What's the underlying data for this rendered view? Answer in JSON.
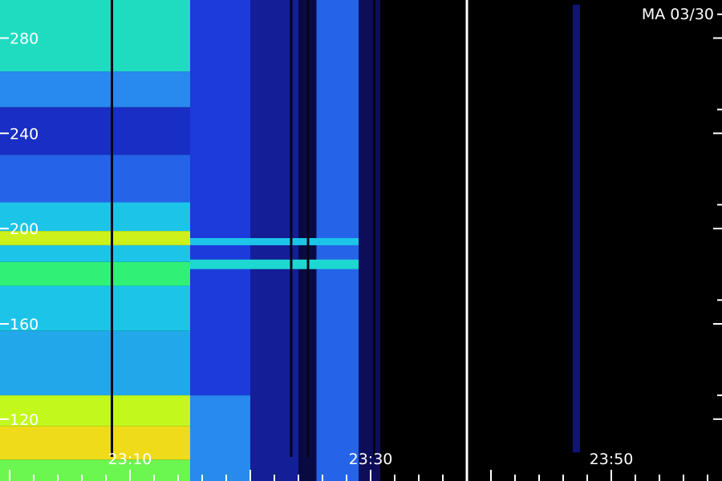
{
  "chart_data": {
    "type": "heatmap",
    "title": "",
    "xlabel": "",
    "ylabel": "",
    "stamp": "MA 03/30",
    "x_tick_labels": [
      "23:10",
      "23:30",
      "23:50"
    ],
    "y_tick_labels": [
      "120",
      "160",
      "200",
      "240",
      "280"
    ],
    "y_ticks": [
      120,
      160,
      200,
      240,
      280
    ],
    "ylim": [
      94,
      296
    ],
    "x_tick_minutes": [
      10,
      30,
      50
    ],
    "xlim_minutes": [
      -0.8,
      59.2
    ],
    "x_minor_step_minutes": 2,
    "gap_start_minutes": 30.8,
    "separator_minutes": 38.0,
    "colormap": [
      "#000000",
      "#10106a",
      "#1a34d8",
      "#2a7cf0",
      "#1ad2e6",
      "#2af07a",
      "#b8ff1c",
      "#ffd21a"
    ],
    "intensity_scale": [
      0,
      1
    ],
    "intensity_regions": [
      {
        "t0": -0.8,
        "t1": 15.0,
        "f0": 94,
        "f1": 103,
        "intensity": 0.78
      },
      {
        "t0": -0.8,
        "t1": 15.0,
        "f0": 103,
        "f1": 117,
        "intensity": 0.97
      },
      {
        "t0": -0.8,
        "t1": 15.0,
        "f0": 117,
        "f1": 130,
        "intensity": 0.88
      },
      {
        "t0": -0.8,
        "t1": 15.0,
        "f0": 130,
        "f1": 157,
        "intensity": 0.5
      },
      {
        "t0": -0.8,
        "t1": 15.0,
        "f0": 157,
        "f1": 176,
        "intensity": 0.55
      },
      {
        "t0": -0.8,
        "t1": 15.0,
        "f0": 176,
        "f1": 186,
        "intensity": 0.72
      },
      {
        "t0": -0.8,
        "t1": 15.0,
        "f0": 186,
        "f1": 193,
        "intensity": 0.55
      },
      {
        "t0": -0.8,
        "t1": 15.0,
        "f0": 193,
        "f1": 199,
        "intensity": 0.9
      },
      {
        "t0": -0.8,
        "t1": 15.0,
        "f0": 199,
        "f1": 211,
        "intensity": 0.55
      },
      {
        "t0": -0.8,
        "t1": 15.0,
        "f0": 211,
        "f1": 231,
        "intensity": 0.38
      },
      {
        "t0": -0.8,
        "t1": 15.0,
        "f0": 231,
        "f1": 251,
        "intensity": 0.26
      },
      {
        "t0": -0.8,
        "t1": 15.0,
        "f0": 251,
        "f1": 266,
        "intensity": 0.45
      },
      {
        "t0": -0.8,
        "t1": 15.0,
        "f0": 266,
        "f1": 296,
        "intensity": 0.62
      },
      {
        "t0": 15.0,
        "t1": 20.0,
        "f0": 94,
        "f1": 130,
        "intensity": 0.45
      },
      {
        "t0": 15.0,
        "t1": 20.0,
        "f0": 130,
        "f1": 296,
        "intensity": 0.3
      },
      {
        "t0": 20.0,
        "t1": 24.0,
        "f0": 94,
        "f1": 296,
        "intensity": 0.2
      },
      {
        "t0": 24.0,
        "t1": 25.5,
        "f0": 94,
        "f1": 296,
        "intensity": 0.09
      },
      {
        "t0": 25.5,
        "t1": 30.8,
        "f0": 94,
        "f1": 296,
        "intensity": 0.38
      },
      {
        "t0": 15.0,
        "t1": 30.8,
        "f0": 183,
        "f1": 187,
        "intensity": 0.6
      },
      {
        "t0": 15.0,
        "t1": 30.8,
        "f0": 193,
        "f1": 196,
        "intensity": 0.55
      },
      {
        "t0": 29.0,
        "t1": 30.8,
        "f0": 94,
        "f1": 296,
        "intensity": 0.12
      }
    ],
    "dark_lines_minutes": [
      8.5,
      23.4,
      24.8,
      30.3
    ],
    "faint_trace": {
      "t0": 46.8,
      "t1": 47.4,
      "f0": 106,
      "f1": 294,
      "intensity": 0.16
    }
  }
}
